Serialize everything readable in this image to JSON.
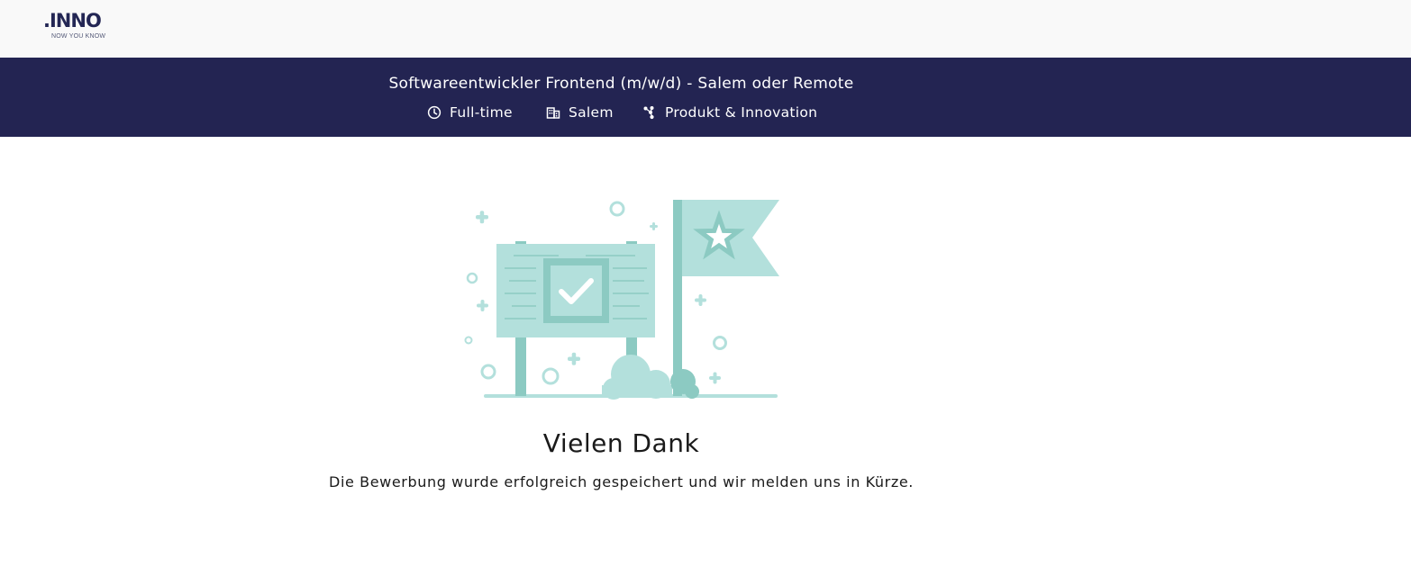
{
  "header": {
    "logo_text": ".INNO",
    "logo_tagline": "NOW YOU KNOW"
  },
  "job": {
    "title": "Softwareentwickler Frontend (m/w/d) - Salem oder Remote",
    "employment_type": "Full-time",
    "location": "Salem",
    "department": "Produkt & Innovation"
  },
  "icons": {
    "employment_type": "clock-icon",
    "location": "building-icon",
    "department": "network-icon"
  },
  "confirmation": {
    "title": "Vielen Dank",
    "message": "Die Bewerbung wurde erfolgreich gespeichert und wir melden uns in Kürze."
  },
  "colors": {
    "banner_bg": "#232452",
    "topbar_bg": "#f9f9f9",
    "illustration_light": "#b3e0dc",
    "illustration_dark": "#8ccac2"
  }
}
